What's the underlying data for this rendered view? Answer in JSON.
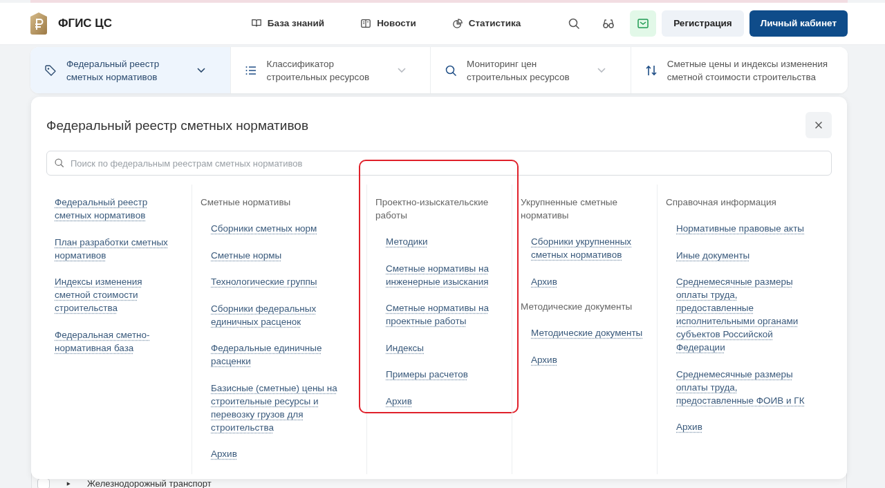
{
  "header": {
    "logo_text": "ФГИС ЦС",
    "nav": [
      {
        "label": "База знаний"
      },
      {
        "label": "Новости"
      },
      {
        "label": "Статистика"
      }
    ],
    "register_button": "Регистрация",
    "cabinet_button": "Личный кабинет"
  },
  "tabs": [
    {
      "label": "Федеральный реестр сметных нормативов",
      "selected": true,
      "dropdown": true
    },
    {
      "label": "Классификатор строительных ресурсов",
      "selected": false,
      "dropdown": true
    },
    {
      "label": "Мониторинг цен строительных ресурсов",
      "selected": false,
      "dropdown": true
    },
    {
      "label": "Сметные цены и индексы изменения сметной стоимости строительства",
      "selected": false,
      "dropdown": false
    }
  ],
  "panel": {
    "title": "Федеральный реестр сметных нормативов",
    "search": {
      "placeholder": "Поиск по федеральным реестрам сметных нормативов"
    },
    "columns": [
      {
        "highlighted": false,
        "groups": [
          {
            "links": [
              "Федеральный реестр сметных нормативов",
              "План разработки сметных нормативов",
              "Индексы изменения сметной стоимости строительства",
              "Федеральная сметно-нормативная база"
            ]
          }
        ]
      },
      {
        "highlighted": false,
        "groups": [
          {
            "heading": "Сметные нормативы",
            "links": [
              "Сборники сметных норм",
              "Сметные нормы",
              "Технологические группы",
              "Сборники федеральных единичных расценок",
              "Федеральные единичные расценки",
              "Базисные (сметные) цены на строительные ресурсы и перевозку грузов для строительства",
              "Архив"
            ]
          }
        ]
      },
      {
        "highlighted": true,
        "groups": [
          {
            "heading": "Проектно-изыскательские работы",
            "links": [
              "Методики",
              "Сметные нормативы на инженерные изыскания",
              "Сметные нормативы на проектные работы",
              "Индексы",
              "Примеры расчетов",
              "Архив"
            ]
          }
        ]
      },
      {
        "highlighted": false,
        "groups": [
          {
            "heading": "Укрупненные сметные нормативы",
            "links": [
              "Сборники укрупненных сметных нормативов",
              "Архив"
            ]
          },
          {
            "heading": "Методические документы",
            "links": [
              "Методические документы",
              "Архив"
            ]
          }
        ]
      },
      {
        "highlighted": false,
        "groups": [
          {
            "heading": "Справочная информация",
            "links": [
              "Нормативные правовые акты",
              "Иные документы",
              "Среднемесячные размеры оплаты труда, предоставленные исполнительными органами субъектов Российской Федерации",
              "Среднемесячные размеры оплаты труда, предоставленные ФОИВ и ГК",
              "Архив"
            ]
          }
        ]
      }
    ]
  },
  "background_row": {
    "checked": false,
    "label": "Железнодорожный транспорт"
  }
}
